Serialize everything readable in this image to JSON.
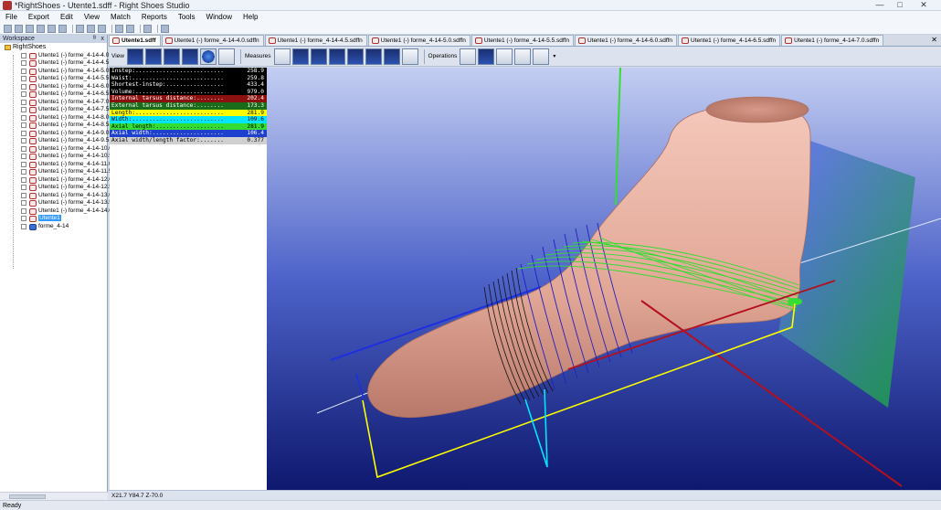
{
  "window": {
    "title": "*RightShoes - Utente1.sdff - Right Shoes Studio",
    "min": "—",
    "max": "□",
    "close": "✕"
  },
  "menu": [
    "File",
    "Export",
    "Edit",
    "View",
    "Match",
    "Reports",
    "Tools",
    "Window",
    "Help"
  ],
  "workspace": {
    "title": "Workspace",
    "pin": "ᴮ",
    "close": "x",
    "root": "RightShoes",
    "items": [
      "Utente1 (-) forme_4-14-4.0",
      "Utente1 (-) forme_4-14-4.5",
      "Utente1 (-) forme_4-14-5.0",
      "Utente1 (-) forme_4-14-5.5",
      "Utente1 (-) forme_4-14-6.0",
      "Utente1 (-) forme_4-14-6.5",
      "Utente1 (-) forme_4-14-7.0",
      "Utente1 (-) forme_4-14-7.5",
      "Utente1 (-) forme_4-14-8.0",
      "Utente1 (-) forme_4-14-8.5",
      "Utente1 (-) forme_4-14-9.0",
      "Utente1 (-) forme_4-14-9.5",
      "Utente1 (-) forme_4-14-10.0",
      "Utente1 (-) forme_4-14-10.5",
      "Utente1 (-) forme_4-14-11.0",
      "Utente1 (-) forme_4-14-11.5",
      "Utente1 (-) forme_4-14-12.0",
      "Utente1 (-) forme_4-14-12.5",
      "Utente1 (-) forme_4-14-13.0",
      "Utente1 (-) forme_4-14-13.5",
      "Utente1 (-) forme_4-14-14.0"
    ],
    "selected": "Utente1",
    "last": "forme_4-14"
  },
  "tabs": [
    {
      "label": "Utente1.sdff",
      "active": true
    },
    {
      "label": "Utente1 (-) forme_4-14-4.0.sdffn"
    },
    {
      "label": "Utente1 (-) forme_4-14-4.5.sdffn"
    },
    {
      "label": "Utente1 (-) forme_4-14-5.0.sdffn"
    },
    {
      "label": "Utente1 (-) forme_4-14-5.5.sdffn"
    },
    {
      "label": "Utente1 (-) forme_4-14-6.0.sdffn"
    },
    {
      "label": "Utente1 (-) forme_4-14-6.5.sdffn"
    },
    {
      "label": "Utente1 (-) forme_4-14-7.0.sdffn"
    }
  ],
  "tab_close": "✕",
  "view_toolbar": {
    "view_label": "View",
    "measures_label": "Measures",
    "operations_label": "Operations",
    "more": "▾"
  },
  "measures": [
    {
      "name": "Instep:..........................",
      "value": "258.9",
      "bg": "#000000",
      "fg": "#ffffff"
    },
    {
      "name": "Waist:...........................",
      "value": "259.8",
      "bg": "#000000",
      "fg": "#ffffff"
    },
    {
      "name": "Shortest-instep:.................",
      "value": "433.4",
      "bg": "#000000",
      "fg": "#ffffff"
    },
    {
      "name": "Volume:..........................",
      "value": "979.0",
      "bg": "#000000",
      "fg": "#ffffff"
    },
    {
      "name": "Internal tarsus distance:........",
      "value": "202.4",
      "bg": "#8b1010",
      "fg": "#ffffff"
    },
    {
      "name": "External tarsus distance:........",
      "value": "173.3",
      "bg": "#1a6b1a",
      "fg": "#ffffff"
    },
    {
      "name": "Length:..........................",
      "value": "281.9",
      "bg": "#ffff00",
      "fg": "#000000"
    },
    {
      "name": "Width:...........................",
      "value": "109.6",
      "bg": "#00e5ff",
      "fg": "#000000"
    },
    {
      "name": "Axial length:....................",
      "value": "281.9",
      "bg": "#33dd33",
      "fg": "#000000"
    },
    {
      "name": "Axial width:.....................",
      "value": "106.4",
      "bg": "#1f3fcf",
      "fg": "#ffffff"
    },
    {
      "name": "Axial width/length factor:.......",
      "value": "0.377",
      "bg": "#d0d0d0",
      "fg": "#000000"
    }
  ],
  "coords": "X21.7 Y84.7 Z-70.0",
  "status": "Ready",
  "colors": {
    "viewport_top": "#c4cef2",
    "viewport_bottom": "#0e186e",
    "foot": "#e8b0a0"
  }
}
